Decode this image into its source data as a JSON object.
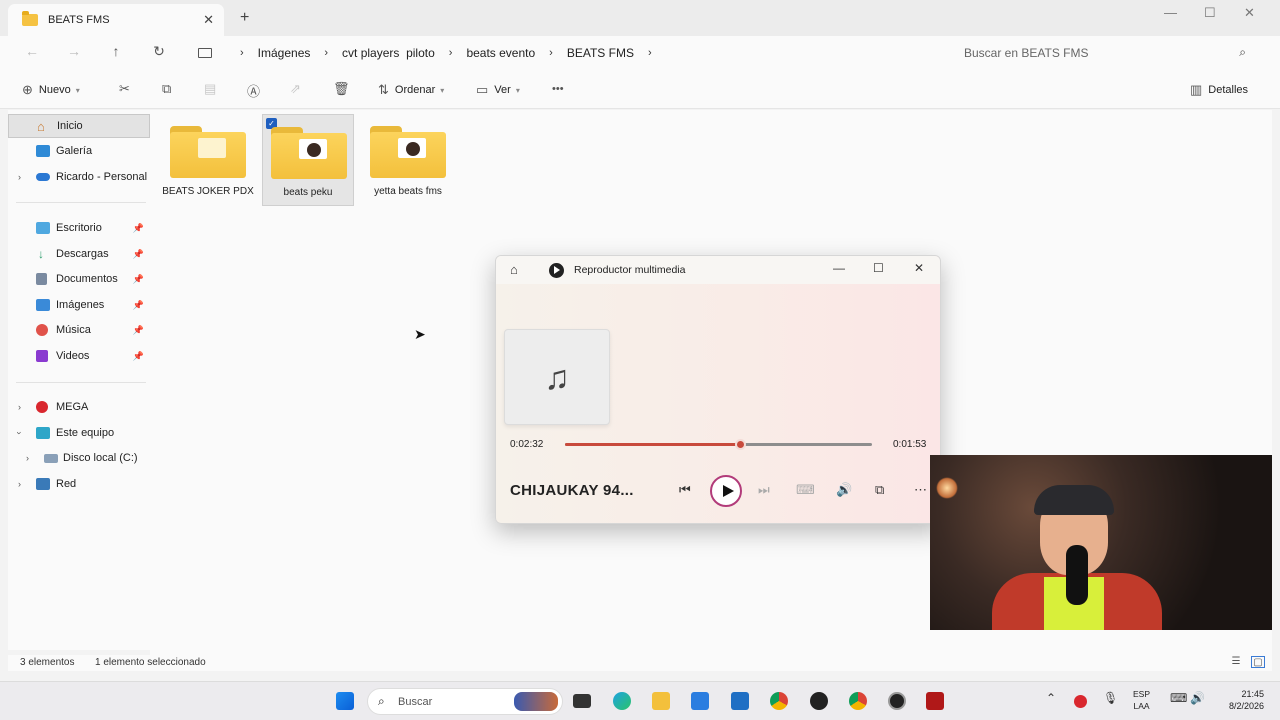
{
  "window": {
    "tab_title": "BEATS FMS",
    "tab_close": "✕",
    "new_tab": "+",
    "minimize": "—",
    "maximize": "☐",
    "close": "✕"
  },
  "address": {
    "crumbs": [
      "Imágenes",
      "cvt players  piloto",
      "beats evento",
      "BEATS FMS"
    ],
    "search_placeholder": "Buscar en BEATS FMS"
  },
  "toolbar": {
    "new_label": "Nuevo",
    "sort_label": "Ordenar",
    "view_label": "Ver",
    "more": "•••",
    "details_label": "Detalles"
  },
  "sidebar": {
    "items": [
      {
        "label": "Inicio",
        "icon": "home-icon",
        "selected": true
      },
      {
        "label": "Galería",
        "icon": "gallery-icon"
      },
      {
        "label": "Ricardo - Personal",
        "icon": "onedrive-icon",
        "expandable": true
      }
    ],
    "quick": [
      {
        "label": "Escritorio",
        "icon": "desktop-icon",
        "color": "#4fa8e0"
      },
      {
        "label": "Descargas",
        "icon": "download-icon",
        "color": "#2f9e6e"
      },
      {
        "label": "Documentos",
        "icon": "documents-icon",
        "color": "#7a8aa0"
      },
      {
        "label": "Imágenes",
        "icon": "pictures-icon",
        "color": "#3a8ad8"
      },
      {
        "label": "Música",
        "icon": "music-icon",
        "color": "#e0524a"
      },
      {
        "label": "Videos",
        "icon": "videos-icon",
        "color": "#8a3ad0"
      }
    ],
    "drives": [
      {
        "label": "MEGA",
        "icon": "mega-icon"
      },
      {
        "label": "Este equipo",
        "icon": "pc-icon"
      },
      {
        "label": "Disco local (C:)",
        "icon": "drive-icon"
      },
      {
        "label": "Red",
        "icon": "network-icon"
      }
    ]
  },
  "folders": [
    {
      "label": "BEATS JOKER PDX",
      "selected": false
    },
    {
      "label": "beats peku",
      "selected": true
    },
    {
      "label": "yetta beats fms",
      "selected": false
    }
  ],
  "status": {
    "count": "3 elementos",
    "selection": "1 elemento seleccionado"
  },
  "player": {
    "app_name": "Reproductor multimedia",
    "elapsed": "0:02:32",
    "remaining": "0:01:53",
    "progress": 0.57,
    "song_title": "CHIJAUKAY 94...",
    "accent": "#c84a3c"
  },
  "taskbar": {
    "search_placeholder": "Buscar",
    "lang_line1": "ESP",
    "lang_line2": "LAA",
    "time": "21:45",
    "date": "8/2/2026"
  }
}
